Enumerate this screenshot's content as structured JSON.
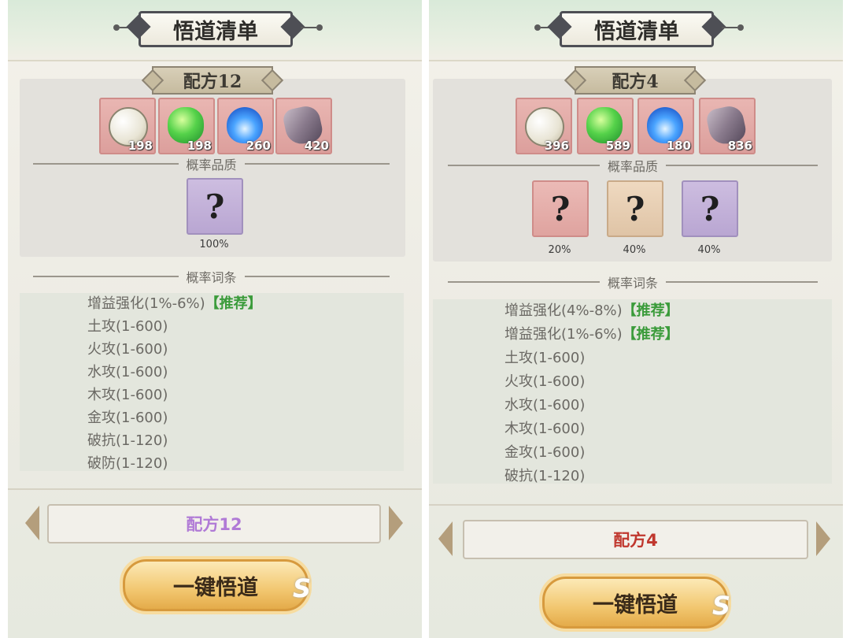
{
  "panels": [
    {
      "title": "悟道清单",
      "recipe_name": "配方12",
      "materials": [
        {
          "icon": "pearl-icon",
          "count": "198"
        },
        {
          "icon": "jade-icon",
          "count": "198"
        },
        {
          "icon": "blue-flame-icon",
          "count": "260"
        },
        {
          "icon": "ore-rock-icon",
          "count": "420"
        }
      ],
      "quality_heading": "概率品质",
      "qualities": [
        {
          "color": "#b9a6d2",
          "symbol": "?",
          "percent": "100%"
        }
      ],
      "affix_heading": "概率词条",
      "affixes": [
        {
          "text": "增益强化(1%-6%)",
          "tag": "【推荐】"
        },
        {
          "text": "土攻(1-600)",
          "tag": ""
        },
        {
          "text": "火攻(1-600)",
          "tag": ""
        },
        {
          "text": "水攻(1-600)",
          "tag": ""
        },
        {
          "text": "木攻(1-600)",
          "tag": ""
        },
        {
          "text": "金攻(1-600)",
          "tag": ""
        },
        {
          "text": "破抗(1-120)",
          "tag": ""
        },
        {
          "text": "破防(1-120)",
          "tag": ""
        }
      ],
      "selector_label": "配方12",
      "selector_color": "#b07ad6",
      "action_label": "一键悟道"
    },
    {
      "title": "悟道清单",
      "recipe_name": "配方4",
      "materials": [
        {
          "icon": "pearl-icon",
          "count": "396"
        },
        {
          "icon": "jade-icon",
          "count": "589"
        },
        {
          "icon": "blue-flame-icon",
          "count": "180"
        },
        {
          "icon": "ore-rock-icon",
          "count": "836"
        }
      ],
      "quality_heading": "概率品质",
      "qualities": [
        {
          "color": "#dfa39f",
          "symbol": "?",
          "percent": "20%"
        },
        {
          "color": "#dfc4a6",
          "symbol": "?",
          "percent": "40%"
        },
        {
          "color": "#b9a6d2",
          "symbol": "?",
          "percent": "40%"
        }
      ],
      "affix_heading": "概率词条",
      "affixes": [
        {
          "text": "增益强化(4%-8%)",
          "tag": "【推荐】"
        },
        {
          "text": "增益强化(1%-6%)",
          "tag": "【推荐】"
        },
        {
          "text": "土攻(1-600)",
          "tag": ""
        },
        {
          "text": "火攻(1-600)",
          "tag": ""
        },
        {
          "text": "水攻(1-600)",
          "tag": ""
        },
        {
          "text": "木攻(1-600)",
          "tag": ""
        },
        {
          "text": "金攻(1-600)",
          "tag": ""
        },
        {
          "text": "破抗(1-120)",
          "tag": ""
        }
      ],
      "selector_label": "配方4",
      "selector_color": "#c0372e",
      "action_label": "一键悟道"
    }
  ]
}
